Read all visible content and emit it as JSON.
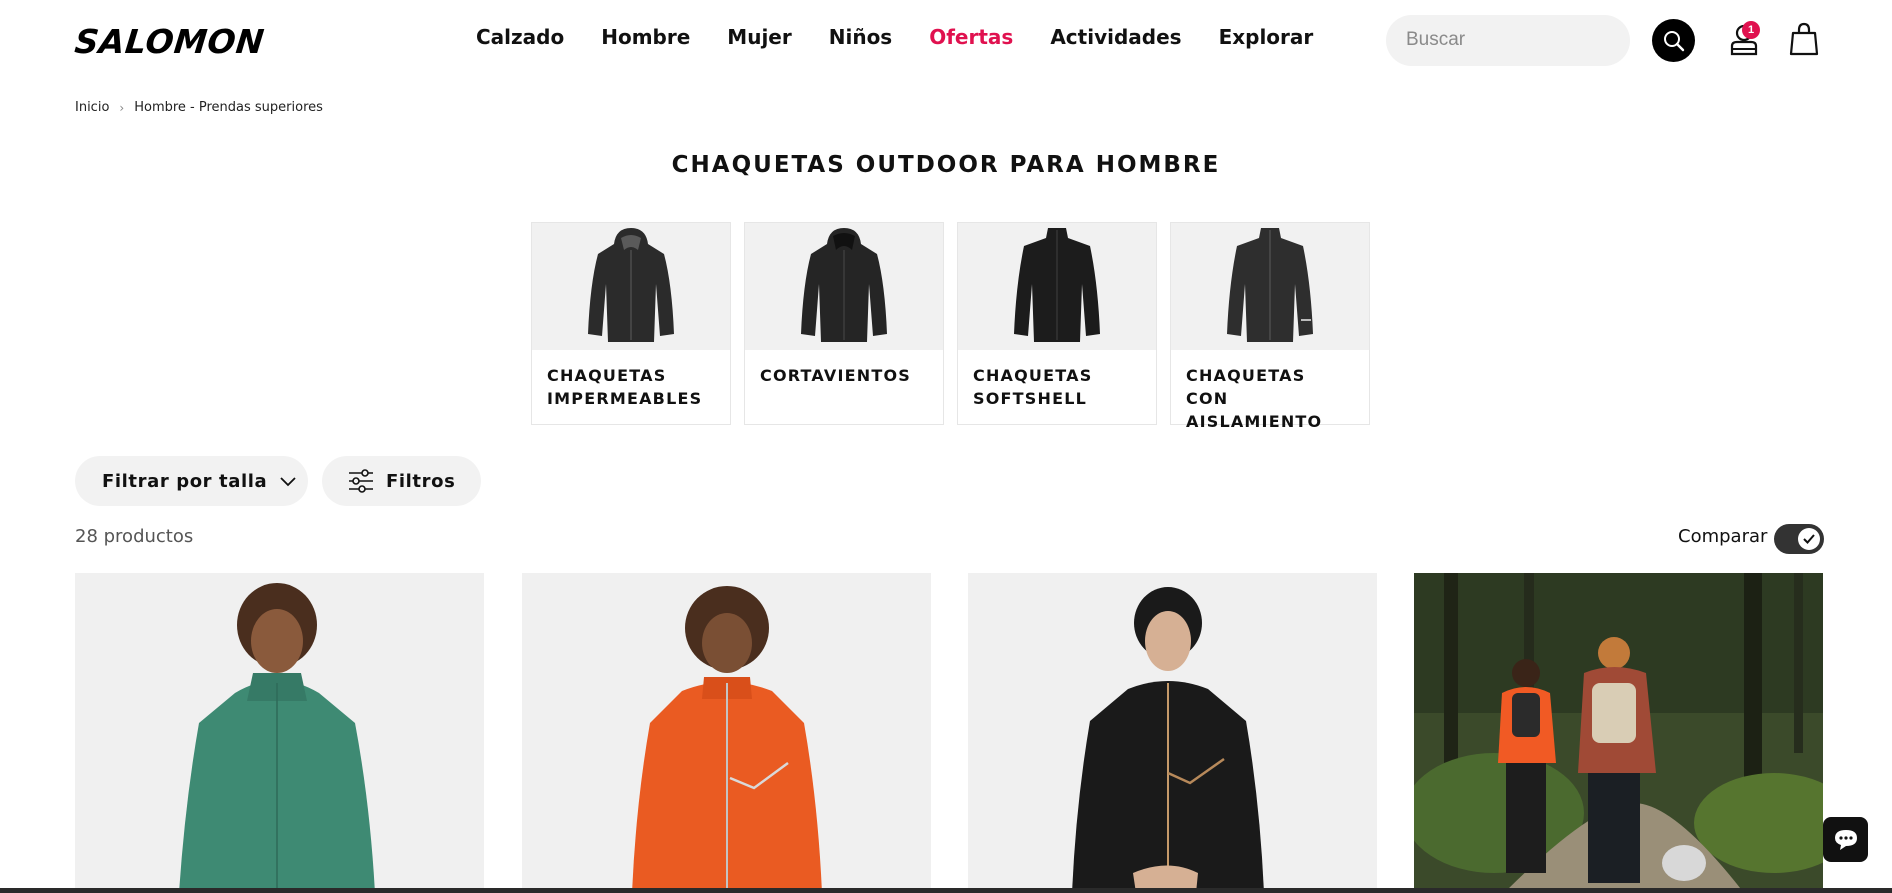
{
  "header": {
    "logo": "SALOMON",
    "nav": [
      {
        "label": "Calzado"
      },
      {
        "label": "Hombre"
      },
      {
        "label": "Mujer"
      },
      {
        "label": "Niños"
      },
      {
        "label": "Ofertas"
      },
      {
        "label": "Actividades"
      },
      {
        "label": "Explorar"
      }
    ],
    "search_placeholder": "Buscar",
    "account_badge": "1",
    "search_icon": "search-icon",
    "account_icon": "user-icon",
    "cart_icon": "shopping-bag-icon"
  },
  "breadcrumb": [
    "Inicio",
    "Hombre - Prendas superiores"
  ],
  "page_title": "CHAQUETAS OUTDOOR PARA HOMBRE",
  "categories": [
    {
      "label": "CHAQUETAS IMPERMEABLES"
    },
    {
      "label": "CORTAVIENTOS"
    },
    {
      "label": "CHAQUETAS SOFTSHELL"
    },
    {
      "label": "CHAQUETAS CON AISLAMIENTO"
    }
  ],
  "filters": {
    "size_label": "Filtrar por talla",
    "all_label": "Filtros"
  },
  "results": {
    "count_label": "28 productos",
    "compare_label": "Comparar",
    "compare_on": true
  },
  "products": [
    {
      "jacket_color": "#3e8a73"
    },
    {
      "jacket_color": "#ea5b22"
    },
    {
      "jacket_color": "#1a1a1a"
    },
    {
      "scene": "trail-hikers"
    }
  ],
  "colors": {
    "accent": "#e0114f",
    "text": "#111111"
  }
}
